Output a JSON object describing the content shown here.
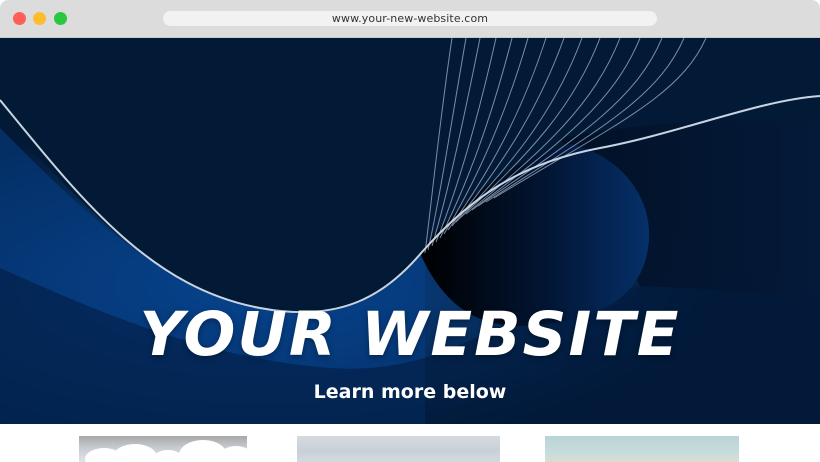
{
  "browser": {
    "url": "www.your-new-website.com"
  },
  "hero": {
    "title": "YOUR WEBSITE",
    "subtitle": "Learn more below"
  },
  "colors": {
    "traffic_close": "#ff5f57",
    "traffic_minimize": "#febc2e",
    "traffic_zoom": "#28c840",
    "hero_dark": "#031a35",
    "hero_blue": "#06306a"
  },
  "thumbnails": [
    {
      "icon": "cloudy-sky-image"
    },
    {
      "icon": "overcast-sky-image"
    },
    {
      "icon": "pale-sky-image"
    }
  ]
}
